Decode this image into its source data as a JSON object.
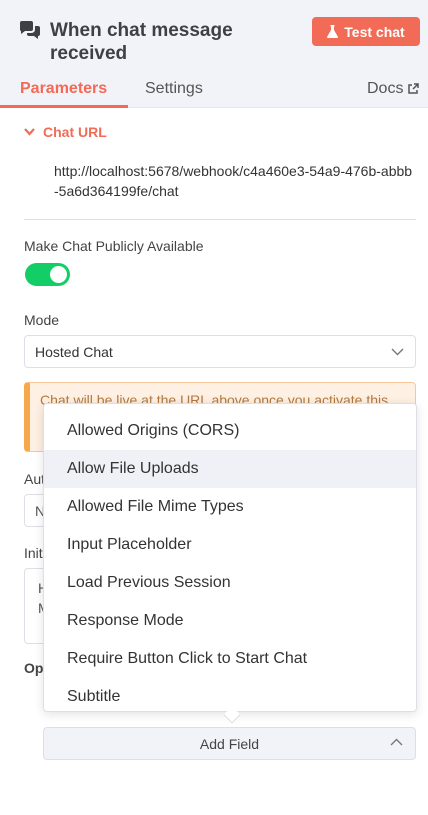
{
  "header": {
    "title": "When chat message received",
    "node_icon": "chat-bubbles-icon",
    "test_button": "Test chat",
    "test_icon": "flask-icon",
    "accent": "#f16b57"
  },
  "tabs": [
    {
      "label": "Parameters",
      "active": true
    },
    {
      "label": "Settings",
      "active": false
    }
  ],
  "docs": {
    "label": "Docs",
    "icon": "external-link-icon"
  },
  "chat_url": {
    "label": "Chat URL",
    "value": "http://localhost:5678/webhook/c4a460e3-54a9-476b-abbb-5a6d364199fe/chat"
  },
  "public": {
    "label": "Make Chat Publicly Available",
    "enabled": true,
    "color": "#13ce66"
  },
  "mode": {
    "label": "Mode",
    "value": "Hosted Chat"
  },
  "notice": {
    "text": "Chat will be live at the URL above once you activate this"
  },
  "partial": {
    "auth_label": "Aut",
    "auth_value": "N",
    "initial_label": "Initi",
    "initial_line1": "H",
    "initial_line2": "M",
    "options_label": "Op"
  },
  "dropdown": {
    "items": [
      "Allowed Origins (CORS)",
      "Allow File Uploads",
      "Allowed File Mime Types",
      "Input Placeholder",
      "Load Previous Session",
      "Response Mode",
      "Require Button Click to Start Chat",
      "Subtitle"
    ],
    "highlighted_index": 1
  },
  "add_field": {
    "label": "Add Field"
  }
}
